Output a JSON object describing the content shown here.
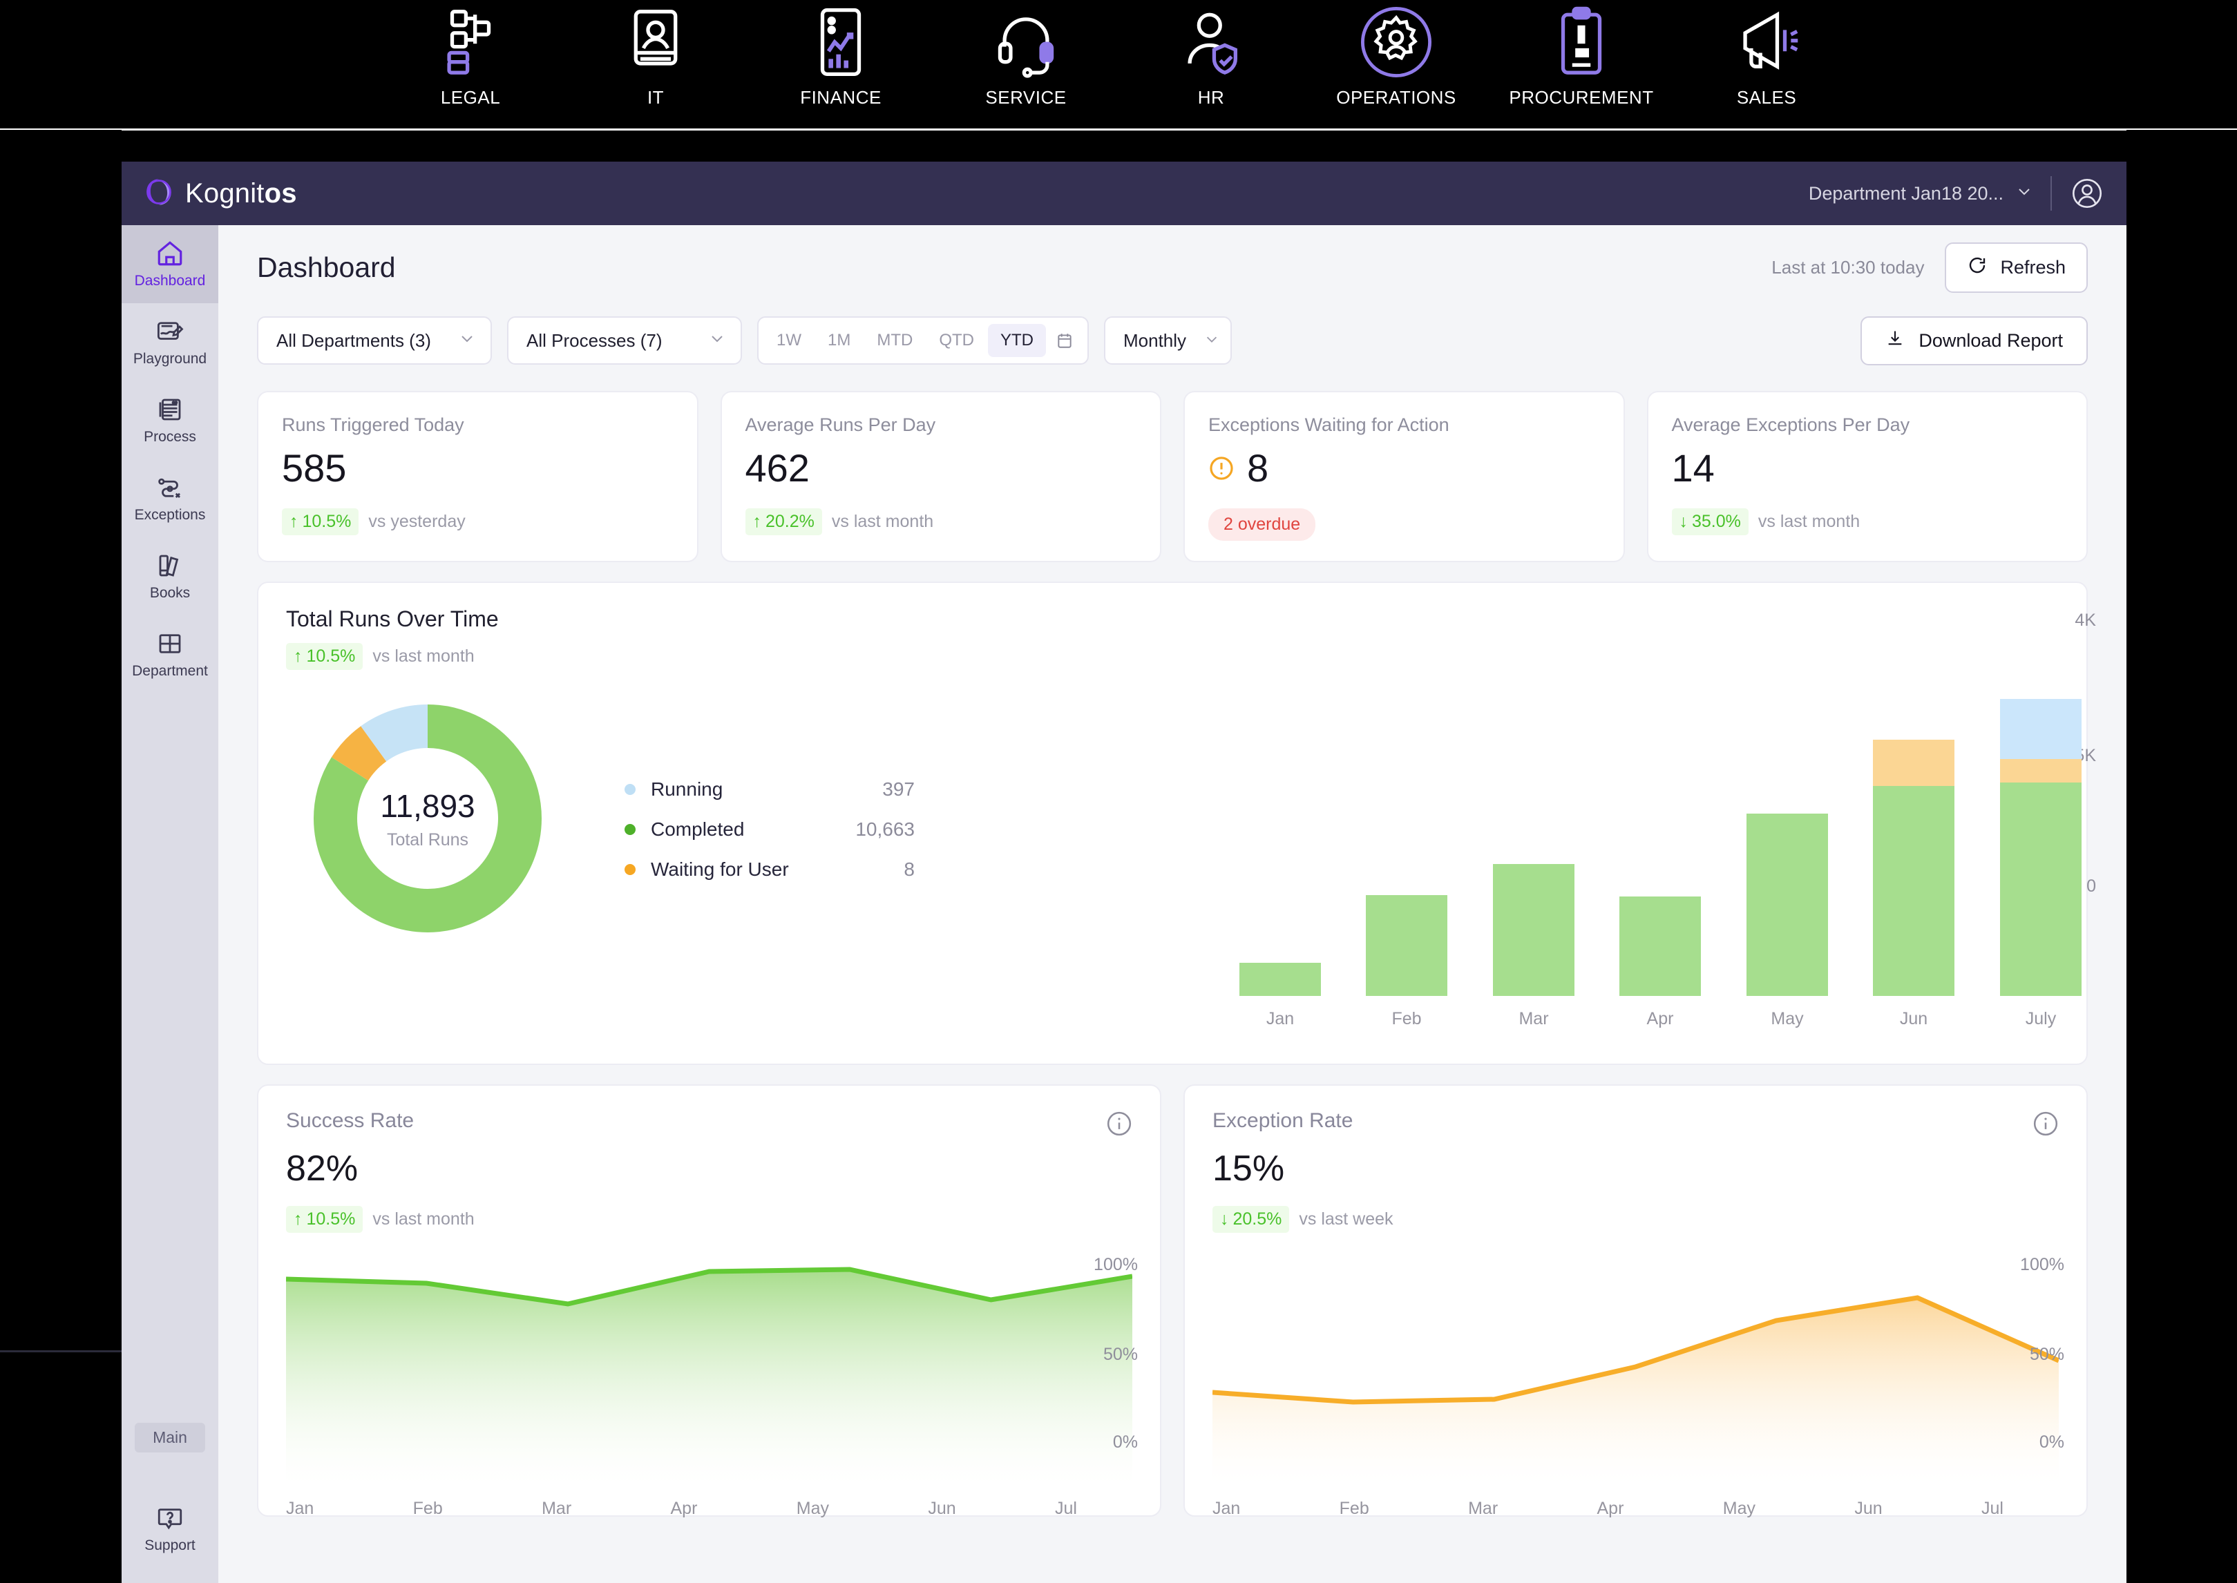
{
  "top_strip": {
    "items": [
      {
        "label": "LEGAL",
        "icon": "gavel-icon"
      },
      {
        "label": "IT",
        "icon": "laptop-user-icon"
      },
      {
        "label": "FINANCE",
        "icon": "finance-chart-icon"
      },
      {
        "label": "SERVICE",
        "icon": "headset-icon"
      },
      {
        "label": "HR",
        "icon": "user-shield-icon"
      },
      {
        "label": "OPERATIONS",
        "icon": "gear-user-icon"
      },
      {
        "label": "PROCUREMENT",
        "icon": "clipboard-pen-icon"
      },
      {
        "label": "SALES",
        "icon": "megaphone-icon"
      }
    ]
  },
  "app_header": {
    "brand_prefix": "Kognit",
    "brand_suffix": "os",
    "department_selector": "Department Jan18 20...",
    "logo_icon": "kognitos-logo-icon",
    "chevron_icon": "chevron-down-icon",
    "avatar_icon": "user-circle-icon"
  },
  "sidebar": {
    "items": [
      {
        "label": "Dashboard",
        "icon": "home-icon",
        "active": true
      },
      {
        "label": "Playground",
        "icon": "notepad-pencil-icon",
        "active": false
      },
      {
        "label": "Process",
        "icon": "document-stack-icon",
        "active": false
      },
      {
        "label": "Exceptions",
        "icon": "flow-error-icon",
        "active": false
      },
      {
        "label": "Books",
        "icon": "books-icon",
        "active": false
      },
      {
        "label": "Department",
        "icon": "grid-icon",
        "active": false
      }
    ],
    "main_chip": "Main",
    "support": {
      "label": "Support",
      "icon": "question-bubble-icon"
    }
  },
  "page": {
    "title": "Dashboard",
    "last_refresh": "Last at 10:30 today",
    "refresh_label": "Refresh",
    "refresh_icon": "refresh-icon",
    "download_label": "Download Report",
    "download_icon": "download-icon"
  },
  "filters": {
    "departments": {
      "value": "All Departments (3)",
      "caret": "chevron-down-icon"
    },
    "processes": {
      "value": "All Processes (7)",
      "caret": "chevron-down-icon"
    },
    "ranges": [
      "1W",
      "1M",
      "MTD",
      "QTD",
      "YTD"
    ],
    "range_selected": "YTD",
    "calendar_icon": "calendar-icon",
    "granularity": {
      "value": "Monthly",
      "caret": "chevron-down-icon"
    }
  },
  "kpis": [
    {
      "title": "Runs Triggered Today",
      "value": "585",
      "delta": "10.5%",
      "delta_dir": "up",
      "note": "vs yesterday",
      "badge": null,
      "alert_icon": null
    },
    {
      "title": "Average Runs Per Day",
      "value": "462",
      "delta": "20.2%",
      "delta_dir": "up",
      "note": "vs last month",
      "badge": null,
      "alert_icon": null
    },
    {
      "title": "Exceptions Waiting for Action",
      "value": "8",
      "delta": null,
      "delta_dir": null,
      "note": null,
      "badge": "2 overdue",
      "alert_icon": "alert-circle-icon"
    },
    {
      "title": "Average Exceptions Per Day",
      "value": "14",
      "delta": "35.0%",
      "delta_dir": "down",
      "note": "vs last month",
      "badge": null,
      "alert_icon": null
    }
  ],
  "runs_card": {
    "title": "Total Runs Over Time",
    "delta": "10.5%",
    "delta_dir": "up",
    "note": "vs last month",
    "donut_total": "11,893",
    "donut_label": "Total Runs",
    "legend": [
      {
        "label": "Running",
        "value": "397",
        "color": "#bfdff5"
      },
      {
        "label": "Completed",
        "value": "10,663",
        "color": "#4eb02a"
      },
      {
        "label": "Waiting for User",
        "value": "8",
        "color": "#f6a723"
      }
    ]
  },
  "colors": {
    "brand_purple": "#6322e0",
    "header_navy": "#343052",
    "green": "#a6de8e",
    "green_line": "#63ca35",
    "orange": "#fbd694",
    "orange_line": "#f7ad29",
    "blue": "#cbe6fb",
    "red": "#e0453f",
    "sidebar": "#dcdce6"
  },
  "chart_data": [
    {
      "type": "pie",
      "title": "Total Runs",
      "center_value": "11,893",
      "labels": [
        "Completed",
        "Waiting for User",
        "Running"
      ],
      "values": [
        10663,
        8,
        397
      ],
      "colors": [
        "#8ed36a",
        "#f6b343",
        "#c6e3f6"
      ],
      "note": "donut; rendered proportions approximately 84% / 6% / 10%",
      "legend_position": "right"
    },
    {
      "type": "bar",
      "title": "Total Runs Over Time",
      "stacked": true,
      "categories": [
        "Jan",
        "Feb",
        "Mar",
        "Apr",
        "May",
        "Jun",
        "July"
      ],
      "series": [
        {
          "name": "Completed",
          "color": "#a6de8e",
          "values": [
            310,
            940,
            1230,
            930,
            1700,
            1960,
            2770
          ]
        },
        {
          "name": "Waiting for User",
          "color": "#fbd694",
          "values": [
            0,
            0,
            0,
            0,
            0,
            430,
            220
          ]
        },
        {
          "name": "Running",
          "color": "#cbe6fb",
          "values": [
            0,
            0,
            0,
            0,
            0,
            0,
            560
          ]
        }
      ],
      "ylabel": "",
      "xlabel": "",
      "yticks": [
        "0",
        "2.5K",
        "4K"
      ],
      "ylim": [
        0,
        4000
      ],
      "grid": false,
      "legend_position": "none"
    },
    {
      "type": "area",
      "title": "Success Rate",
      "headline_value": "82%",
      "delta": "10.5%",
      "delta_dir": "up",
      "note": "vs last month",
      "categories": [
        "Jan",
        "Feb",
        "Mar",
        "Apr",
        "May",
        "Jun",
        "Jul"
      ],
      "values": [
        94,
        92,
        83,
        99,
        100,
        85,
        96
      ],
      "yticks": [
        "0%",
        "50%",
        "100%"
      ],
      "ylim": [
        0,
        100
      ],
      "line_color": "#63ca35",
      "fill_color": "#b9e5a1",
      "grid": false,
      "legend_position": "none"
    },
    {
      "type": "area",
      "title": "Exception Rate",
      "headline_value": "15%",
      "delta": "20.5%",
      "delta_dir": "down",
      "note": "vs last week",
      "categories": [
        "Jan",
        "Feb",
        "Mar",
        "Apr",
        "May",
        "Jun",
        "Jul"
      ],
      "values": [
        25,
        21,
        22,
        40,
        73,
        82,
        50
      ],
      "yticks": [
        "0%",
        "50%",
        "100%"
      ],
      "ylim": [
        0,
        100
      ],
      "line_color": "#f7ad29",
      "fill_color": "#fbe0b0",
      "grid": false,
      "legend_position": "none"
    }
  ],
  "bottom_charts": [
    {
      "title": "Success Rate",
      "value": "82%",
      "delta": "10.5%",
      "delta_dir": "up",
      "note": "vs last month",
      "info_icon": "info-icon",
      "x_labels": [
        "Jan",
        "Feb",
        "Mar",
        "Apr",
        "May",
        "Jun",
        "Jul"
      ],
      "y_labels": [
        "100%",
        "50%",
        "0%"
      ]
    },
    {
      "title": "Exception Rate",
      "value": "15%",
      "delta": "20.5%",
      "delta_dir": "down",
      "note": "vs last week",
      "info_icon": "info-icon",
      "x_labels": [
        "Jan",
        "Feb",
        "Mar",
        "Apr",
        "May",
        "Jun",
        "Jul"
      ],
      "y_labels": [
        "100%",
        "50%",
        "0%"
      ]
    }
  ],
  "bar_chart_axis": {
    "y_labels": [
      "4K",
      "2.5K",
      "0"
    ],
    "x_labels": [
      "Jan",
      "Feb",
      "Mar",
      "Apr",
      "May",
      "Jun",
      "July"
    ]
  }
}
